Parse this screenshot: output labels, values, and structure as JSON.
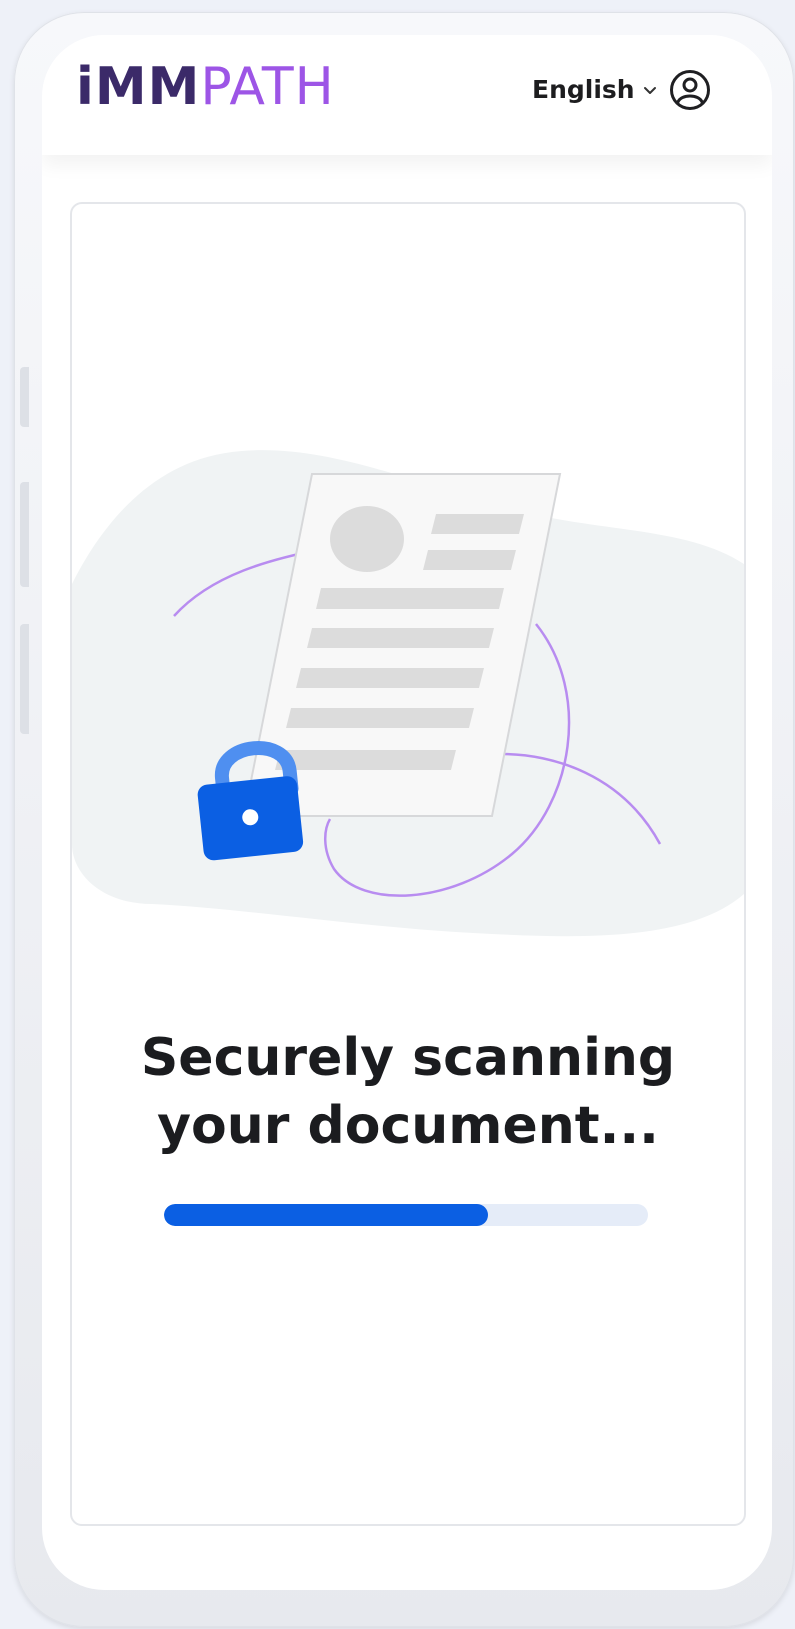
{
  "header": {
    "logo_part1": "iMM",
    "logo_part2": "PATH",
    "language": "English",
    "language_icon": "chevron-down-icon",
    "profile_icon": "user-circle-icon"
  },
  "main": {
    "title_line1": "Securely scanning",
    "title_line2": "your document...",
    "progress": 0.67
  },
  "colors": {
    "logo_dark": "#3b2a69",
    "logo_accent": "#9d55e6",
    "primary": "#0b5fe3",
    "progress_track": "#e5ecf8",
    "illustration_blob": "#f0f3f4",
    "orbit_line": "#b88cf0"
  },
  "illustration": {
    "document_icon": "document-icon",
    "lock_icon": "lock-icon"
  }
}
